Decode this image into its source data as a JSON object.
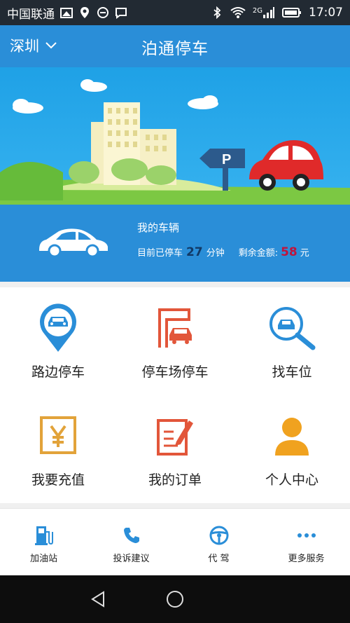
{
  "status_bar": {
    "carrier": "中国联通",
    "network": "2G",
    "time": "17:07"
  },
  "header": {
    "city": "深圳",
    "title": "泊通停车"
  },
  "vehicle": {
    "title": "我的车辆",
    "parked_prefix": "目前已停车",
    "parked_minutes": "27",
    "parked_unit": "分钟",
    "balance_label": "剩余金额:",
    "balance_value": "58",
    "balance_unit": "元"
  },
  "menu": [
    {
      "label": "路边停车",
      "icon": "roadside-parking-icon"
    },
    {
      "label": "停车场停车",
      "icon": "parking-lot-icon"
    },
    {
      "label": "找车位",
      "icon": "find-spot-icon"
    },
    {
      "label": "我要充值",
      "icon": "recharge-icon"
    },
    {
      "label": "我的订单",
      "icon": "orders-icon"
    },
    {
      "label": "个人中心",
      "icon": "user-center-icon"
    }
  ],
  "bottom_nav": [
    {
      "label": "加油站",
      "icon": "gas-station-icon"
    },
    {
      "label": "投诉建议",
      "icon": "phone-icon"
    },
    {
      "label": "代 驾",
      "icon": "steering-wheel-icon"
    },
    {
      "label": "更多服务",
      "icon": "more-icon"
    }
  ],
  "banner": {
    "sign_text": "P"
  },
  "colors": {
    "primary": "#2a8ed8",
    "banner_sky": "#1fa1e6",
    "accent_red": "#e2563a",
    "icon_blue": "#2a8ed8",
    "icon_orange": "#f0a21f",
    "icon_yellow": "#e2a33a"
  }
}
